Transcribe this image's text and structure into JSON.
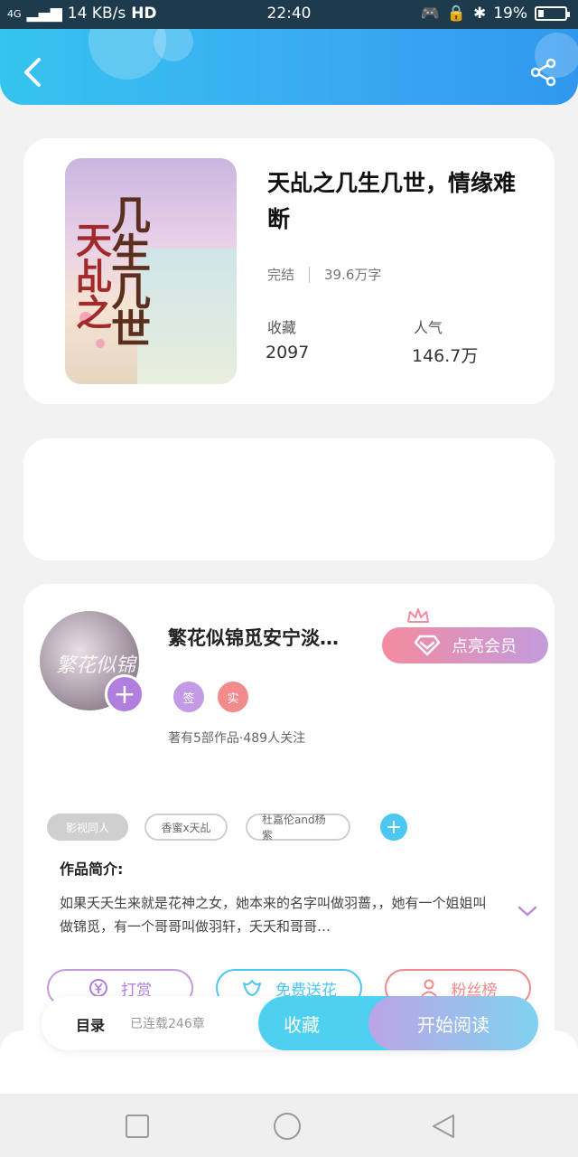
{
  "status_bar": {
    "network": "4G",
    "speed": "14 KB/s",
    "hd": "HD",
    "time": "22:40",
    "battery": "19%"
  },
  "book": {
    "title": "天乩之几生几世，情缘难断",
    "status": "完结",
    "word_count": "39.6万字",
    "favorites_label": "收藏",
    "favorites_value": "2097",
    "popularity_label": "人气",
    "popularity_value": "146.7万",
    "cover_text_main": "几生几世",
    "cover_text_side": "天乩之"
  },
  "author": {
    "name": "繁花似锦觅安宁淡…",
    "vip_label": "点亮会员",
    "badges": [
      "签",
      "实"
    ],
    "stats": "著有5部作品·489人关注",
    "avatar_text": "繁花似锦"
  },
  "tags": [
    "影视同人",
    "香蜜x天乩",
    "杜嘉伦and杨紫"
  ],
  "intro": {
    "label": "作品简介:",
    "text": "如果夭夭生来就是花神之女，她本来的名字叫做羽蔷，，她有一个姐姐叫做锦觅，有一个哥哥叫做羽轩，夭夭和哥哥…"
  },
  "actions": {
    "tip": "打赏",
    "flower": "免费送花",
    "fans": "粉丝榜"
  },
  "bottom_bar": {
    "toc": "目录",
    "serial_status": "已连载246章",
    "favorite": "收藏",
    "start_reading": "开始阅读"
  },
  "colors": {
    "header_start": "#35c4ee",
    "header_end": "#2f98ee",
    "vip_start": "#f38ba0",
    "vip_end": "#c39bdd",
    "tip": "#b07fe0",
    "flower": "#4cc7ef",
    "fans": "#f08a8a"
  },
  "icons": [
    "back-arrow-icon",
    "share-icon",
    "diamond-icon",
    "crown-icon",
    "plus-icon",
    "chevron-down-icon",
    "yen-icon",
    "flower-icon",
    "user-icon",
    "square-icon",
    "circle-icon",
    "triangle-back-icon"
  ]
}
